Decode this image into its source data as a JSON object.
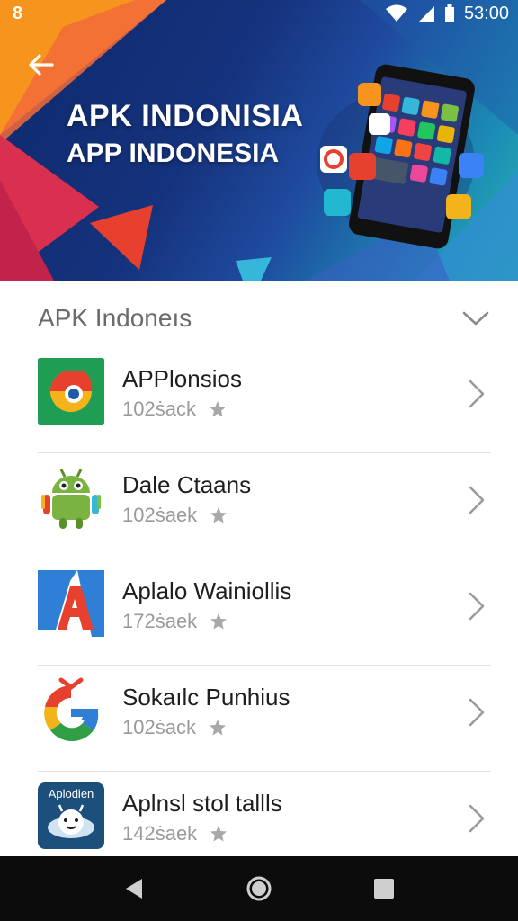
{
  "status_bar": {
    "left_glyph": "8",
    "time": "53:00"
  },
  "hero": {
    "title": "APK INDONISIA",
    "subtitle": "APP INDONESIA"
  },
  "section": {
    "title": "APK Indoneıs"
  },
  "apps": [
    {
      "name": "APPlonsios",
      "meta": "102ṡack",
      "icon": "chrome-like-icon"
    },
    {
      "name": "Dale Ctaans",
      "meta": "102ṡaek",
      "icon": "android-robot-icon"
    },
    {
      "name": "Aplalo Wainiollis",
      "meta": "172ṡaek",
      "icon": "red-a-icon"
    },
    {
      "name": "Sokaılc Punhius",
      "meta": "102ṡack",
      "icon": "g-logo-icon"
    },
    {
      "name": "Aplnsl stol tallls",
      "meta": "142ṡaek",
      "icon": "aplodien-icon",
      "icon_label": "Aplodien"
    }
  ],
  "colors": {
    "hero_navy": "#15327c",
    "hero_teal": "#2bb3a8",
    "accent_orange": "#f7941d",
    "accent_red": "#e8402f",
    "nav_bg": "#0c0c0c"
  }
}
